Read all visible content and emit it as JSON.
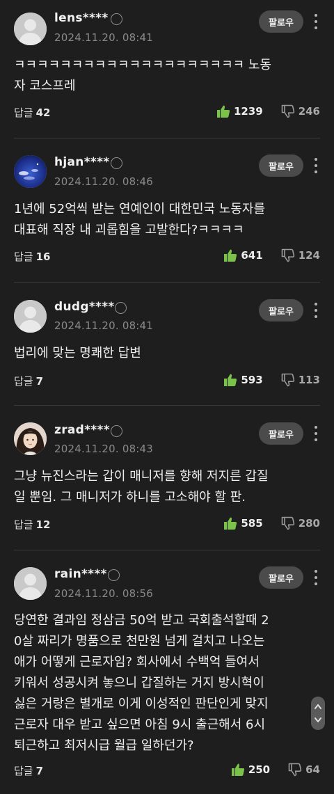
{
  "colors": {
    "background": "#1e1e1e",
    "like_icon": "#7bc24b",
    "dislike_icon": "#9a9a9a",
    "follow_button": "#4b4b4b"
  },
  "comments": [
    {
      "username": "lens****",
      "timestamp": "2024.11.20. 08:41",
      "follow_label": "팔로우",
      "text": "ㅋㅋㅋㅋㅋㅋㅋㅋㅋㅋㅋㅋㅋㅋㅋㅋㅋㅋㅋㅋ 노동\n자 코스프레",
      "reply_label": "답글",
      "reply_count": "42",
      "likes": "1239",
      "dislikes": "246",
      "avatar": "default"
    },
    {
      "username": "hjan****",
      "timestamp": "2024.11.20. 08:46",
      "follow_label": "팔로우",
      "text": "1년에 52억씩 받는 연예인이 대한민국 노동자를\n대표해 직장 내 괴롭힘을 고발한다?ㅋㅋㅋㅋ",
      "reply_label": "답글",
      "reply_count": "16",
      "likes": "641",
      "dislikes": "124",
      "avatar": "sky"
    },
    {
      "username": "dudg****",
      "timestamp": "2024.11.20. 08:41",
      "follow_label": "팔로우",
      "text": "법리에 맞는 명쾌한 답변",
      "reply_label": "답글",
      "reply_count": "7",
      "likes": "593",
      "dislikes": "113",
      "avatar": "default"
    },
    {
      "username": "zrad****",
      "timestamp": "2024.11.20. 08:43",
      "follow_label": "팔로우",
      "text": "그냥 뉴진스라는 갑이 매니저를 향해 저지른 갑질\n일 뿐임. 그 매니저가 하니를 고소해야 할 판.",
      "reply_label": "답글",
      "reply_count": "12",
      "likes": "585",
      "dislikes": "280",
      "avatar": "photo"
    },
    {
      "username": "rain****",
      "timestamp": "2024.11.20. 08:56",
      "follow_label": "팔로우",
      "text": "당연한 결과임 정삼금 50억 받고 국회출석할때 2\n0살 짜리가 명품으로 천만원 넘게 걸치고 나오는\n애가 어떻게 근로자임? 회사에서 수백억 들여서\n키워서 성공시켜 놓으니 갑질하는 거지 방시혁이\n싫은 거랑은 별개로 이게 이성적인 판단인게 맞지\n근로자 대우 받고 싶으면 아침 9시 출근해서 6시\n퇴근하고 최저시급 월급 일하던가?",
      "reply_label": "답글",
      "reply_count": "7",
      "likes": "250",
      "dislikes": "64",
      "avatar": "default"
    }
  ]
}
